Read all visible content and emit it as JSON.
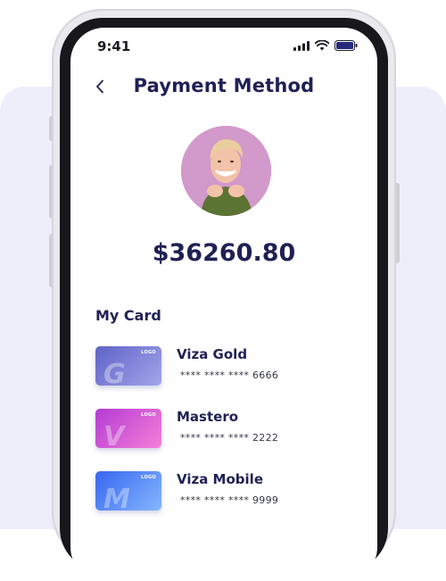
{
  "status_bar": {
    "time": "9:41",
    "icons": [
      "signal-icon",
      "wifi-icon",
      "battery-icon"
    ]
  },
  "header": {
    "back_icon": "chevron-left-icon",
    "title": "Payment Method"
  },
  "profile": {
    "balance": "$36260.80"
  },
  "my_card": {
    "heading": "My Card",
    "cards": [
      {
        "name": "Viza Gold",
        "number": "**** **** **** 6666",
        "logo": "LOGO",
        "initial": "G",
        "gradient": [
          "#6b6fcf",
          "#9a9ce6"
        ]
      },
      {
        "name": "Mastero",
        "number": "**** **** **** 2222",
        "logo": "LOGO",
        "initial": "V",
        "gradient": [
          "#c23fd1",
          "#f37bd6"
        ]
      },
      {
        "name": "Viza Mobile",
        "number": "**** **** **** 9999",
        "logo": "LOGO",
        "initial": "M",
        "gradient": [
          "#3d6ff2",
          "#7fb0ff"
        ]
      }
    ]
  },
  "colors": {
    "title": "#1f2154",
    "background_panel": "#eeeefb",
    "avatar_bg": "#d299cb"
  }
}
